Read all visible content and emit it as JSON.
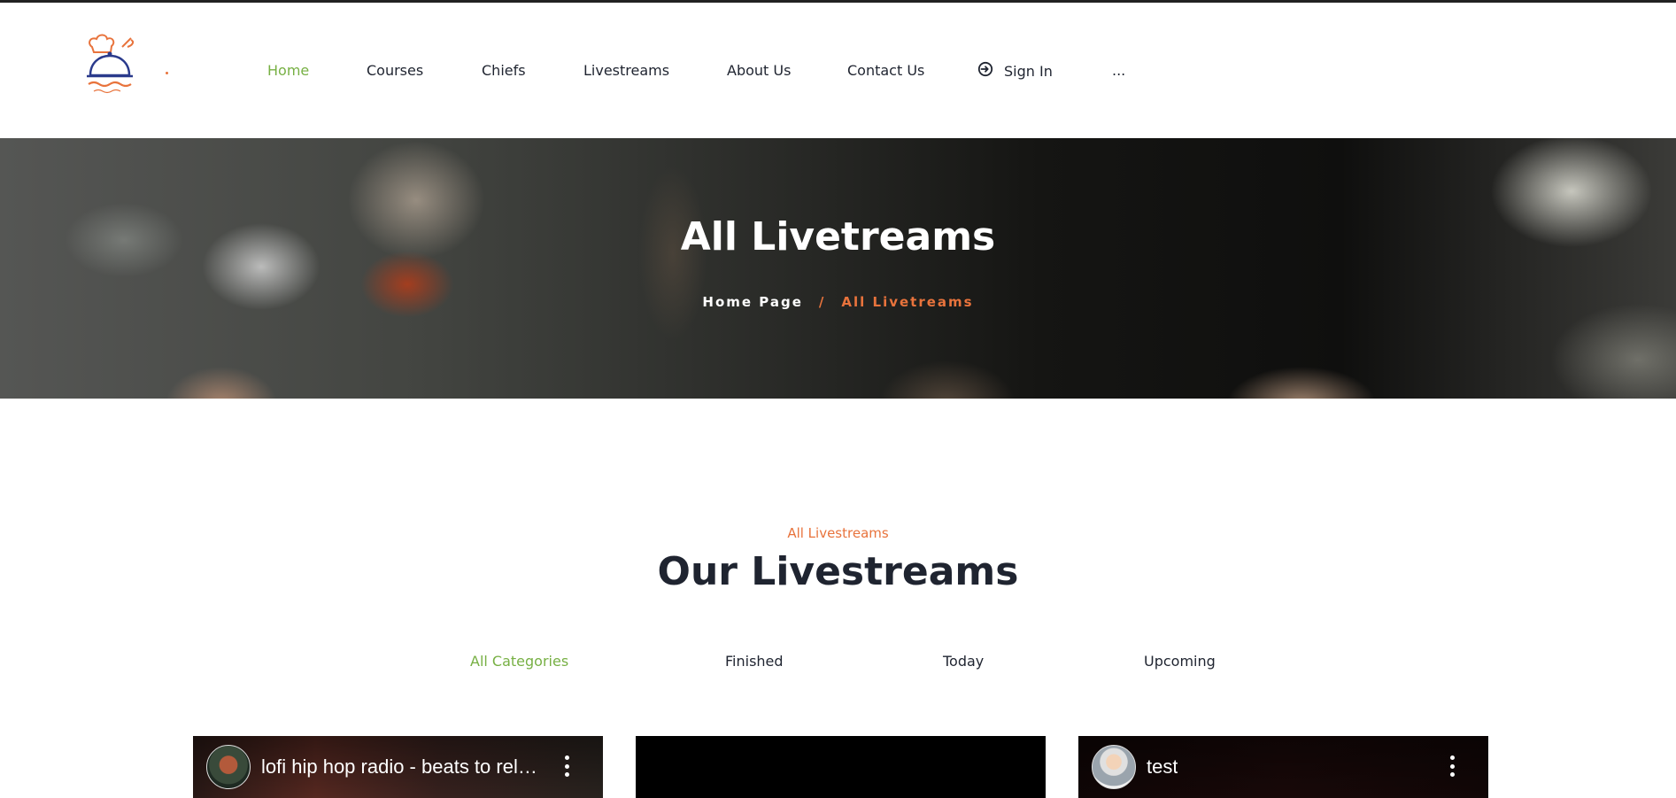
{
  "brand": {
    "logo_icon": "chef-hat-cloche-logo-icon",
    "accent_color": "#e8733c",
    "active_color": "#77b044"
  },
  "nav": {
    "items": [
      {
        "label": "Home",
        "active": true
      },
      {
        "label": "Courses",
        "active": false
      },
      {
        "label": "Chiefs",
        "active": false
      },
      {
        "label": "Livestreams",
        "active": false
      },
      {
        "label": "About Us",
        "active": false
      },
      {
        "label": "Contact Us",
        "active": false
      }
    ],
    "signin_label": "Sign In",
    "more_label": "..."
  },
  "hero": {
    "title": "All Livetreams",
    "breadcrumb_home": "Home Page",
    "breadcrumb_sep": "/",
    "breadcrumb_current": "All Livetreams"
  },
  "section": {
    "subtitle": "All Livestreams",
    "title": "Our Livestreams"
  },
  "tabs": [
    {
      "label": "All Categories",
      "active": true
    },
    {
      "label": "Finished",
      "active": false
    },
    {
      "label": "Today",
      "active": false
    },
    {
      "label": "Upcoming",
      "active": false
    }
  ],
  "videos": [
    {
      "title": "lofi hip hop radio - beats to relax/study to",
      "has_avatar": true
    },
    {
      "title": "",
      "has_avatar": false
    },
    {
      "title": "test",
      "has_avatar": true
    }
  ]
}
